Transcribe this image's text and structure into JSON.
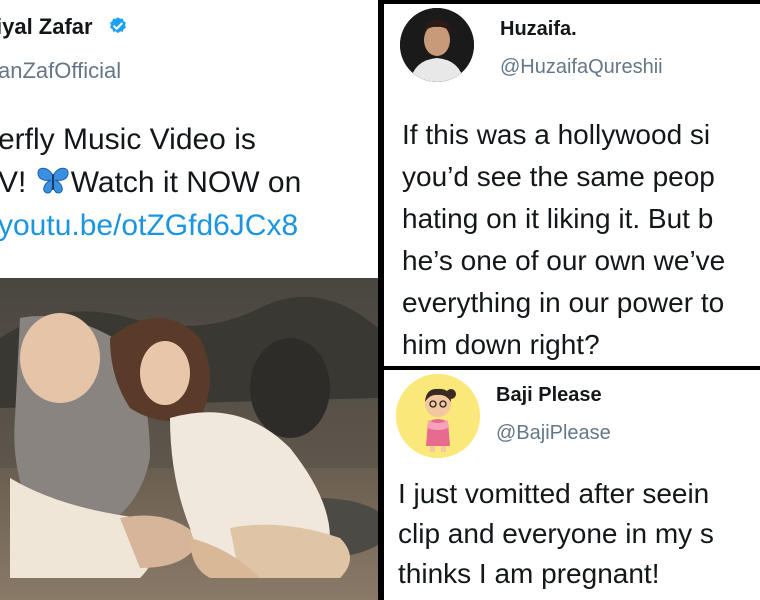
{
  "left_tweet": {
    "name": "iyal Zafar",
    "handle": "anZafOfficial",
    "lines": [
      "erfly Music Video is",
      "V! ",
      "Watch it NOW on"
    ],
    "link": "youtu.be/otZGfd6JCx8",
    "verified_icon": "verified-badge-icon",
    "emoji_icon": "butterfly-icon",
    "colors": {
      "link": "#1b95e0",
      "verified": "#1da1f2"
    }
  },
  "right_top_tweet": {
    "name": "Huzaifa.",
    "handle": "@HuzaifaQureshii",
    "lines": [
      "If this was a hollywood si",
      "you’d see the same peop",
      "hating on it liking it. But b",
      "he’s one of our own we’ve",
      "everything in our power to",
      "him down right?"
    ]
  },
  "right_bottom_tweet": {
    "name": "Baji Please",
    "handle": "@BajiPlease",
    "lines": [
      "I just vomitted after seein",
      "clip and everyone in my s",
      "thinks I am pregnant!"
    ]
  }
}
